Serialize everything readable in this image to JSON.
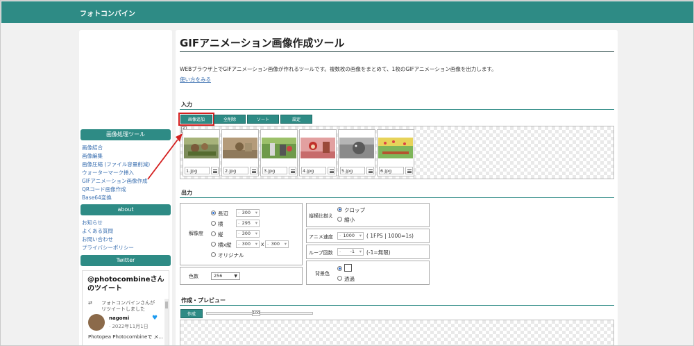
{
  "header": {
    "brand": "フォトコンバイン"
  },
  "sidebar": {
    "image_tools_heading": "画像処理ツール",
    "tools": [
      "画像結合",
      "画像編集",
      "画像圧縮 (ファイル容量削減)",
      "ウォーターマーク挿入",
      "GIFアニメーション画像作成",
      "QRコード画像作成",
      "Base64変換"
    ],
    "about_heading": "about",
    "about_links": [
      "お知らせ",
      "よくある質問",
      "お問い合わせ",
      "プライバシーポリシー"
    ],
    "twitter_heading": "Twitter",
    "tweet": {
      "title": "@photocombineさんのツイート",
      "retweet_text": "フォトコンバインさんがリツイートしました",
      "name": "nagomi",
      "date": "· 2022年11月1日",
      "body": "Photopea Photocombineで メ..."
    }
  },
  "main": {
    "title": "GIFアニメーション画像作成ツール",
    "description": "WEBブラウザ上でGIFアニメーション画像が作れるツールです。複数枚の画像をまとめて、1枚のGIFアニメーション画像を出力します。",
    "howto_link": "使い方をみる",
    "input": {
      "heading": "入力",
      "buttons": [
        "画像追加",
        "全削除",
        "ソート",
        "設定"
      ],
      "count": "6",
      "files": [
        "1.jpg",
        "2.jpg",
        "3.jpg",
        "4.jpg",
        "5.jpg",
        "6.jpg"
      ]
    },
    "output": {
      "heading": "出力",
      "resolution_label": "解像度",
      "long_side_label": "長辺",
      "long_side_value": "300",
      "width_label": "横",
      "width_value": "295",
      "height_label": "縦",
      "height_value": "300",
      "wh_label": "横x縦",
      "wh_w_value": "300",
      "wh_sep": "x",
      "wh_h_value": "300",
      "original_label": "オリジナル",
      "colors_label": "色数",
      "colors_value": "256",
      "aspect_label": "縦横比揃え",
      "crop_label": "クロップ",
      "shrink_label": "縮小",
      "speed_label": "アニメ速度",
      "speed_value": "1000",
      "speed_note": "( 1FPS | 1000=1s)",
      "loop_label": "ループ回数",
      "loop_value": "-1",
      "loop_note": "(-1=無限)",
      "bg_label": "背景色",
      "transparent_label": "透過"
    },
    "preview": {
      "heading": "作成・プレビュー",
      "create_button": "作成",
      "quality_value": "100"
    }
  },
  "colors": {
    "accent": "#2e8b85",
    "highlight": "#d42020",
    "link": "#3a6fb0"
  }
}
